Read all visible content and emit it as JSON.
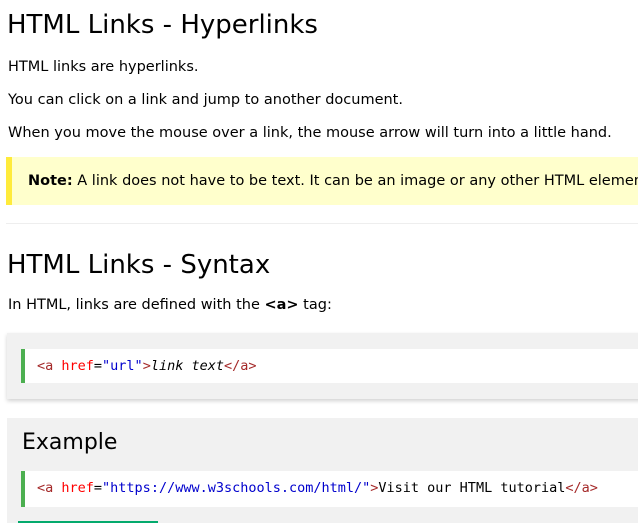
{
  "page": {
    "heading_main": "HTML Links - Hyperlinks",
    "paragraphs": [
      "HTML links are hyperlinks.",
      "You can click on a link and jump to another document.",
      "When you move the mouse over a link, the mouse arrow will turn into a little hand."
    ],
    "note": {
      "label": "Note:",
      "text": " A link does not have to be text. It can be an image or any other HTML element."
    },
    "heading_syntax": "HTML Links - Syntax",
    "syntax_intro": {
      "before": "In HTML, links are defined with the ",
      "tag": "<a>",
      "after": " tag:"
    },
    "syntax_code": {
      "open_tag_start": "<a",
      "attr": " href",
      "eq": "=",
      "value": "\"url\"",
      "open_tag_end": ">",
      "link_text": "link text",
      "close_tag": "</a>"
    },
    "example": {
      "title": "Example",
      "code": {
        "open_tag_start": "<a",
        "attr": " href",
        "eq": "=",
        "value": "\"https://www.w3schools.com/html/\"",
        "open_tag_end": ">",
        "link_text": "Visit our HTML tutorial",
        "close_tag": "</a>"
      }
    }
  },
  "colors": {
    "note_bg": "#ffffcc",
    "note_border": "#ffeb3b",
    "code_border": "#4CAF50",
    "code_tag": "#a52a2a",
    "code_attr": "#ff0000",
    "code_value": "#0000cd",
    "button_green": "#04AA6D"
  }
}
